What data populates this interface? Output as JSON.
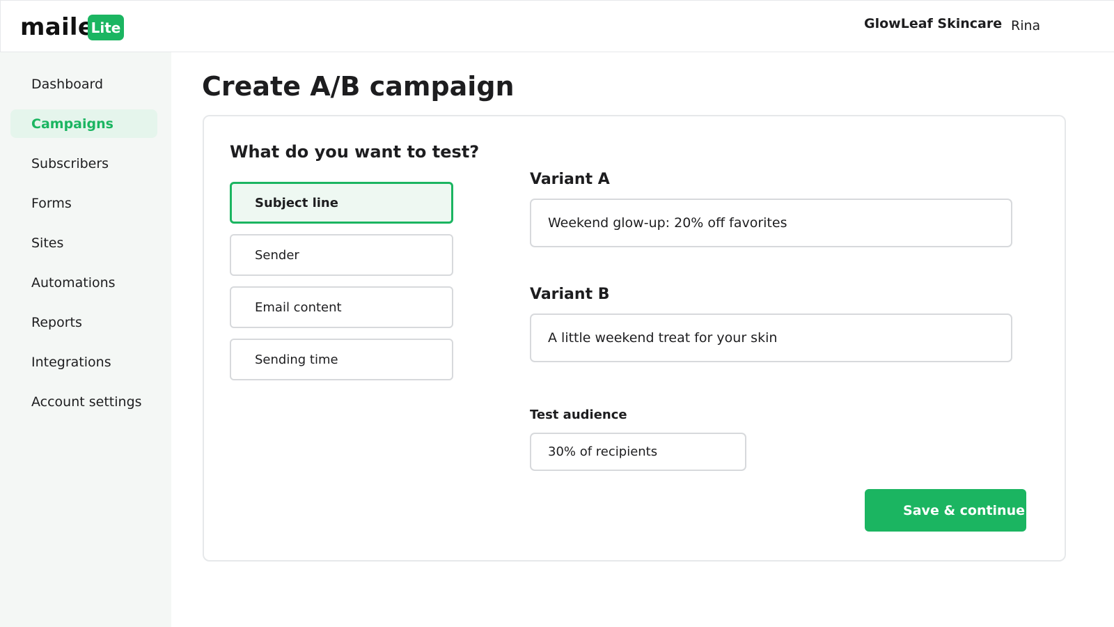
{
  "brand": {
    "logo_text": "maile",
    "logo_badge": "Lite",
    "accent_color": "#1bb561"
  },
  "header": {
    "workspace": "GlowLeaf Skincare",
    "user": "Rina"
  },
  "sidebar": {
    "items": [
      {
        "label": "Dashboard",
        "active": false
      },
      {
        "label": "Campaigns",
        "active": true
      },
      {
        "label": "Subscribers",
        "active": false
      },
      {
        "label": "Forms",
        "active": false
      },
      {
        "label": "Sites",
        "active": false
      },
      {
        "label": "Automations",
        "active": false
      },
      {
        "label": "Reports",
        "active": false
      },
      {
        "label": "Integrations",
        "active": false
      },
      {
        "label": "Account settings",
        "active": false
      }
    ]
  },
  "page": {
    "title": "Create A/B campaign"
  },
  "test": {
    "question": "What do you want to test?",
    "options": [
      {
        "label": "Subject line",
        "selected": true
      },
      {
        "label": "Sender",
        "selected": false
      },
      {
        "label": "Email content",
        "selected": false
      },
      {
        "label": "Sending time",
        "selected": false
      }
    ]
  },
  "variants": {
    "a": {
      "label": "Variant A",
      "value": "Weekend glow-up: 20% off favorites"
    },
    "b": {
      "label": "Variant B",
      "value": "A little weekend treat for your skin"
    }
  },
  "audience": {
    "label": "Test audience",
    "value": "30% of recipients"
  },
  "actions": {
    "save_label": "Save & continue"
  }
}
